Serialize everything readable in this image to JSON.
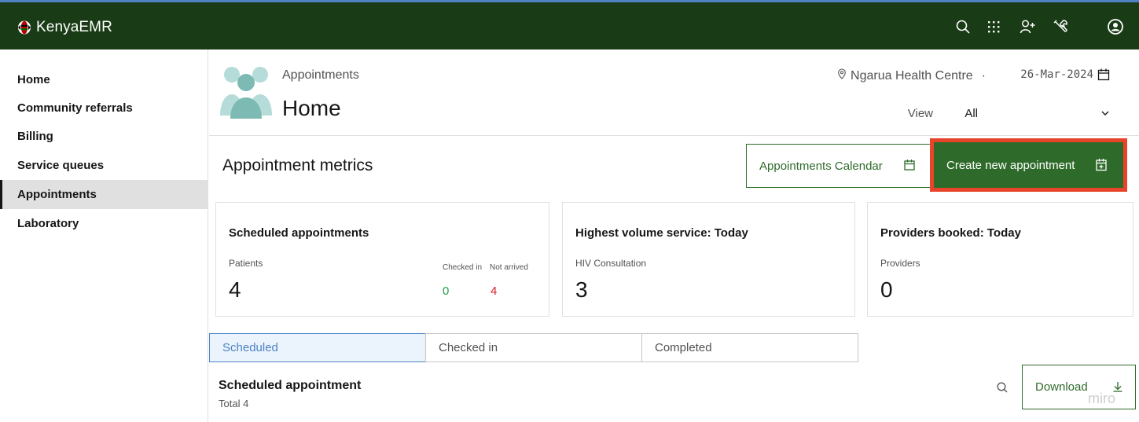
{
  "app": {
    "name": "KenyaEMR"
  },
  "topbar": {
    "icons": [
      "search-icon",
      "app-grid-icon",
      "add-user-icon",
      "tools-icon",
      "user-avatar-icon"
    ]
  },
  "nav": {
    "items": [
      {
        "label": "Home"
      },
      {
        "label": "Community referrals"
      },
      {
        "label": "Billing"
      },
      {
        "label": "Service queues"
      },
      {
        "label": "Appointments",
        "active": true
      },
      {
        "label": "Laboratory"
      }
    ]
  },
  "header": {
    "subtitle": "Appointments",
    "title": "Home",
    "location": "Ngarua Health Centre",
    "separator": "·",
    "date": "26-Mar-2024",
    "view_label": "View",
    "view_value": "All"
  },
  "metrics": {
    "title": "Appointment metrics",
    "calendar_button": "Appointments Calendar",
    "create_button": "Create new appointment",
    "cards": {
      "scheduled": {
        "title": "Scheduled appointments",
        "label": "Patients",
        "value": "4",
        "checked_in_label": "Checked in",
        "checked_in_value": "0",
        "not_arrived_label": "Not arrived",
        "not_arrived_value": "4"
      },
      "volume": {
        "title": "Highest volume service: Today",
        "label": "HIV Consultation",
        "value": "3"
      },
      "providers": {
        "title": "Providers booked: Today",
        "label": "Providers",
        "value": "0"
      }
    }
  },
  "tabs": [
    {
      "label": "Scheduled",
      "selected": true
    },
    {
      "label": "Checked in"
    },
    {
      "label": "Completed"
    }
  ],
  "list": {
    "title": "Scheduled appointment",
    "total": "Total 4",
    "download_button": "Download"
  },
  "watermark": "miro",
  "colors": {
    "topbar": "#193b15",
    "primary": "#2e6b2a",
    "highlight": "#e8442a",
    "tab_selected": "#4d83c4",
    "checked_in": "#24a148",
    "not_arrived": "#da1e28"
  }
}
